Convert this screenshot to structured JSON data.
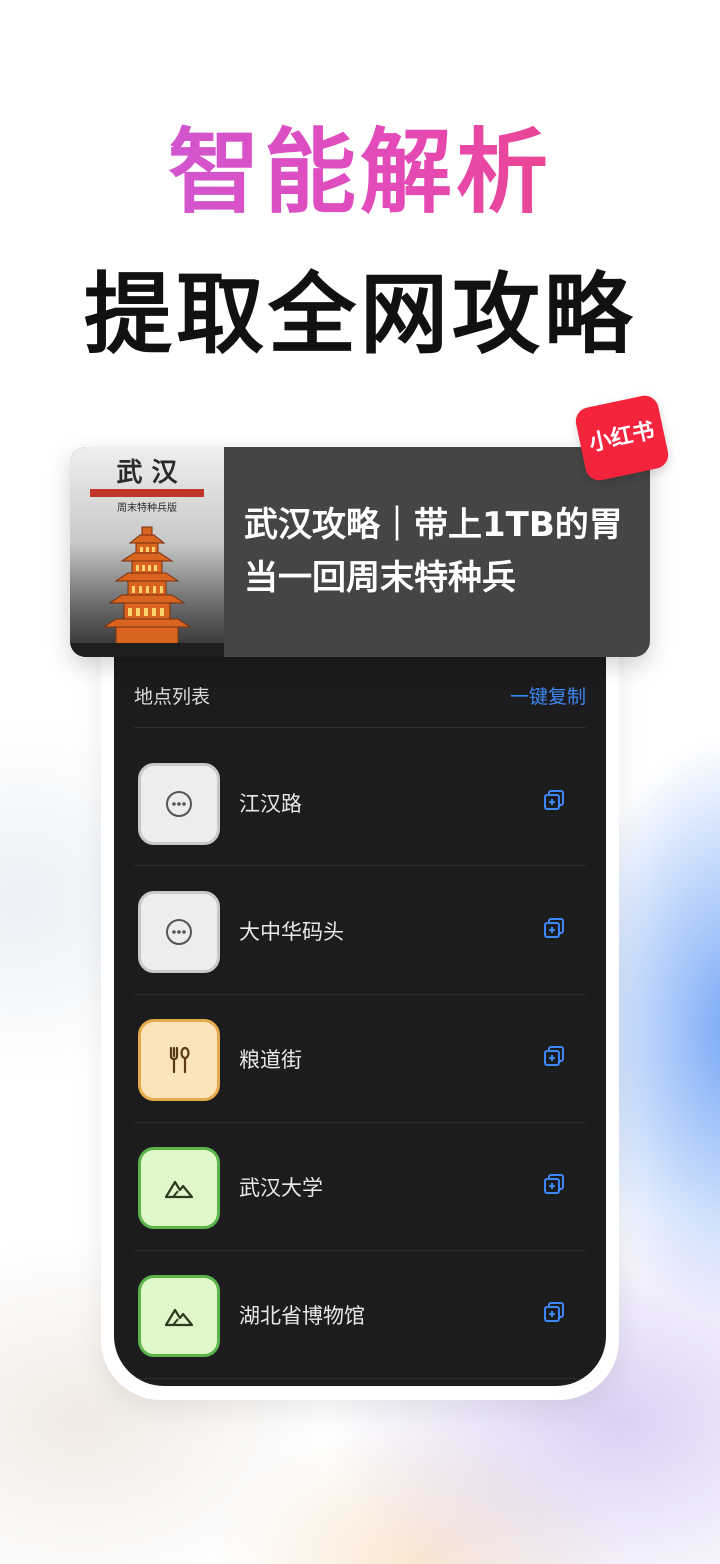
{
  "headline": {
    "line1": "智能解析",
    "line2": "提取全网攻略"
  },
  "card": {
    "title": "武汉攻略｜带上1TB的胃当一回周末特种兵",
    "thumb_title": "武 汉",
    "thumb_subtitle": "周末特种兵版",
    "badge": "小红书"
  },
  "list": {
    "title": "地点列表",
    "copy_all": "一键复制",
    "items": [
      {
        "label": "江汉路",
        "icon": "more-dots-icon",
        "color": "gray"
      },
      {
        "label": "大中华码头",
        "icon": "more-dots-icon",
        "color": "gray"
      },
      {
        "label": "粮道街",
        "icon": "fork-spoon-icon",
        "color": "orange"
      },
      {
        "label": "武汉大学",
        "icon": "mountain-icon",
        "color": "green"
      },
      {
        "label": "湖北省博物馆",
        "icon": "mountain-icon",
        "color": "green"
      }
    ]
  },
  "colors": {
    "accent_blue": "#3d86f5",
    "badge_red": "#f5243d",
    "gradient_start": "#c45de0",
    "gradient_end": "#f2406a"
  }
}
